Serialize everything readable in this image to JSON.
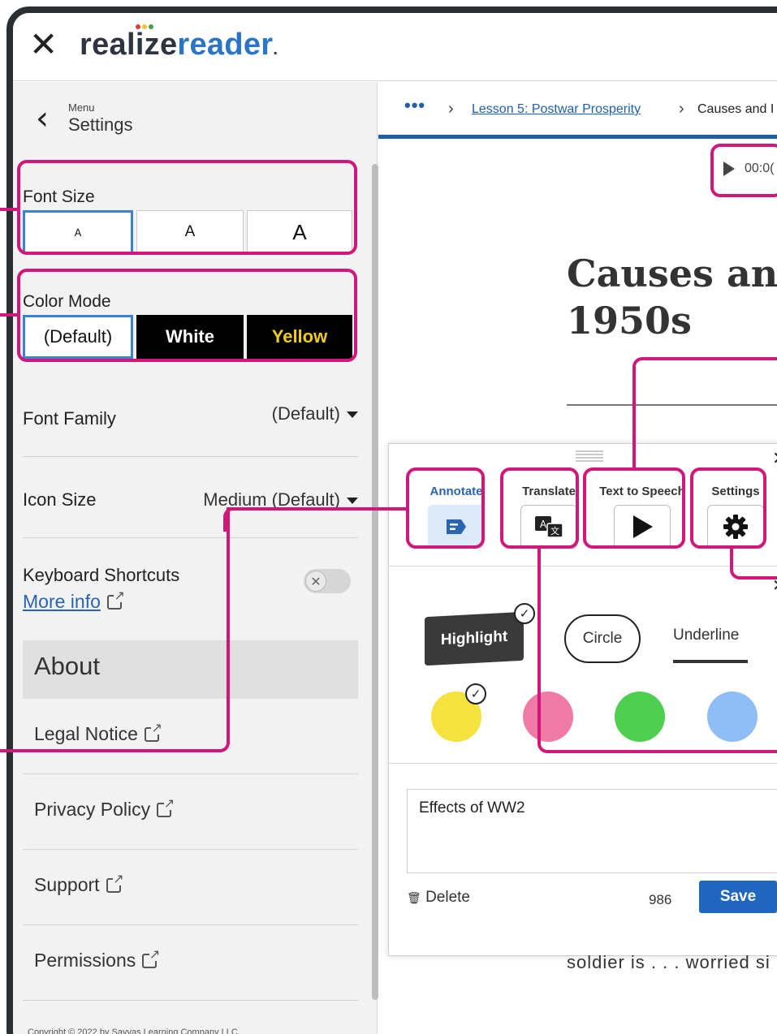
{
  "app": {
    "close_glyph": "✕",
    "logo_part1": "realize",
    "logo_part2": "reader",
    "logo_suffix": "."
  },
  "sidebar": {
    "menu_label": "Menu",
    "title": "Settings",
    "font_size": {
      "label": "Font Size",
      "options": [
        "A",
        "A",
        "A"
      ],
      "selected_index": 0
    },
    "color_mode": {
      "label": "Color Mode",
      "options": [
        "(Default)",
        "White",
        "Yellow"
      ],
      "selected_index": 0
    },
    "font_family": {
      "label": "Font Family",
      "value": "(Default)"
    },
    "icon_size": {
      "label": "Icon Size",
      "value": "Medium (Default)"
    },
    "keyboard_shortcuts": {
      "label": "Keyboard Shortcuts",
      "link": "More info",
      "enabled": false
    },
    "about_heading": "About",
    "links": [
      "Legal Notice",
      "Privacy Policy",
      "Support",
      "Permissions"
    ],
    "copyright": "Copyright © 2022 by Savvas Learning Company LLC."
  },
  "main": {
    "breadcrumb": {
      "more": "•••",
      "link": "Lesson 5: Postwar Prosperity",
      "current": "Causes and I"
    },
    "audio_time": "00:0(",
    "headline": "Causes an\n1950s",
    "bottom_text": "soldier is . . . worried si"
  },
  "tools": {
    "items": [
      {
        "label": "Annotate",
        "icon": "annotate-icon",
        "active": true
      },
      {
        "label": "Translate",
        "icon": "translate-icon",
        "active": false
      },
      {
        "label": "Text to Speech",
        "icon": "play-icon",
        "active": false
      },
      {
        "label": "Settings",
        "icon": "gear-icon",
        "active": false
      }
    ],
    "styles": [
      "Highlight",
      "Circle",
      "Underline"
    ],
    "selected_style": "Highlight",
    "colors": [
      "#f5e23c",
      "#f07aa6",
      "#4fcf4f",
      "#8fbef7"
    ],
    "selected_color_index": 0,
    "note": {
      "text": "Effects of WW2",
      "delete_label": "Delete",
      "count": "986",
      "save_label": "Save"
    }
  },
  "colors": {
    "callout": "#d1177a",
    "accent": "#1f66c1"
  }
}
